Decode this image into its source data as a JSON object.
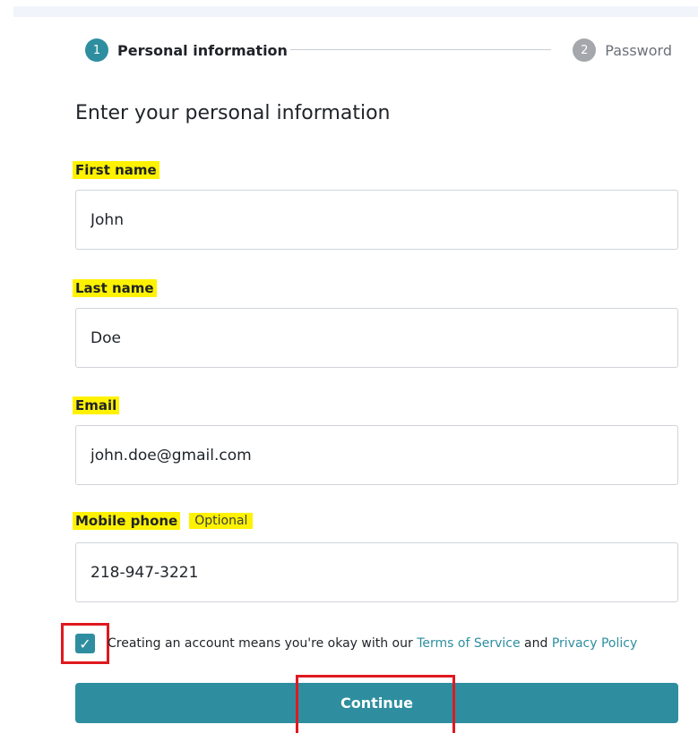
{
  "steps": [
    {
      "number": "1",
      "label": "Personal information"
    },
    {
      "number": "2",
      "label": "Password"
    }
  ],
  "form": {
    "title": "Enter your personal information",
    "first_name": {
      "label": "First name",
      "value": "John"
    },
    "last_name": {
      "label": "Last name",
      "value": "Doe"
    },
    "email": {
      "label": "Email",
      "value": "john.doe@gmail.com"
    },
    "mobile": {
      "label": "Mobile phone",
      "optional": "Optional",
      "value": "218-947-3221"
    }
  },
  "agreement": {
    "checked": true,
    "check_glyph": "✓",
    "text_before": "Creating an account means you're okay with our ",
    "terms_link": "Terms of Service",
    "and": " and ",
    "privacy_link": "Privacy Policy"
  },
  "continue_label": "Continue",
  "colors": {
    "accent": "#2e8ea0",
    "highlight": "#fff200",
    "annotation": "#e0191f"
  }
}
